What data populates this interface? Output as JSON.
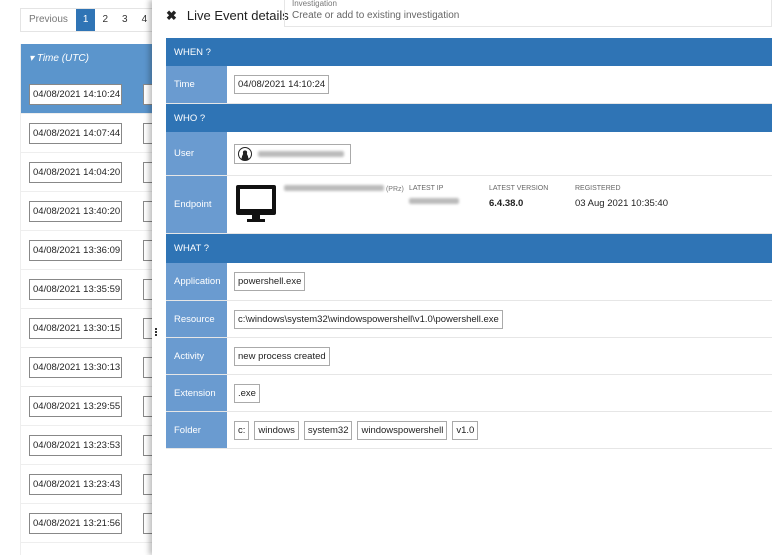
{
  "pager": {
    "previous": "Previous",
    "pages": [
      "1",
      "2",
      "3",
      "4"
    ],
    "active": "1"
  },
  "table": {
    "header_time": "Time (UTC)",
    "rows": [
      "04/08/2021 14:10:24",
      "04/08/2021 14:07:44",
      "04/08/2021 14:04:20",
      "04/08/2021 13:40:20",
      "04/08/2021 13:36:09",
      "04/08/2021 13:35:59",
      "04/08/2021 13:30:15",
      "04/08/2021 13:30:13",
      "04/08/2021 13:29:55",
      "04/08/2021 13:23:53",
      "04/08/2021 13:23:43",
      "04/08/2021 13:21:56"
    ]
  },
  "panel": {
    "close": "✖",
    "title": "Live Event details",
    "investigation_label": "Investigation",
    "investigation_placeholder": "Create or add to existing investigation",
    "when": "WHEN ?",
    "time_label": "Time",
    "time": "04/08/2021 14:10:24",
    "who": "WHO ?",
    "user_label": "User",
    "endpoint_label": "Endpoint",
    "endpoint_suffix": "(PRz)",
    "latest_ip_label": "LATEST IP",
    "latest_version_label": "LATEST VERSION",
    "latest_version": "6.4.38.0",
    "registered_label": "REGISTERED",
    "registered": "03 Aug 2021 10:35:40",
    "what": "WHAT ?",
    "application_label": "Application",
    "application": "powershell.exe",
    "resource_label": "Resource",
    "resource": "c:\\windows\\system32\\windowspowershell\\v1.0\\powershell.exe",
    "activity_label": "Activity",
    "activity": "new process created",
    "extension_label": "Extension",
    "extension": ".exe",
    "folder_label": "Folder",
    "folders": [
      "c:",
      "windows",
      "system32",
      "windowspowershell",
      "v1.0"
    ]
  }
}
